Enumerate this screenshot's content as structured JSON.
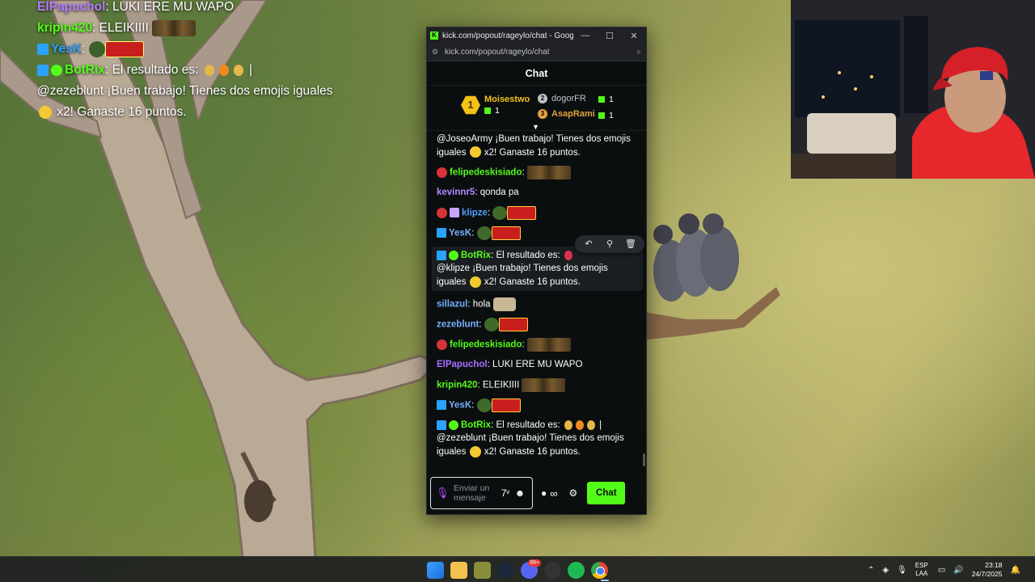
{
  "overlay_chat": [
    {
      "user": "ElPapuchol",
      "text": ": LUKI ERE MU WAPO"
    },
    {
      "user": "kripin420",
      "text": ": ELEIKIIII"
    },
    {
      "user": "YesK",
      "text": ":"
    },
    {
      "user": "BotRix",
      "text": ": El resultado es:",
      "continuation": "@zezeblunt ¡Buen trabajo! Tienes dos emojis iguales",
      "tail": "x2! Ganaste 16 puntos."
    }
  ],
  "window": {
    "title": "kick.com/popout/rageylo/chat - Google Chr...",
    "url": "kick.com/popout/rageylo/chat",
    "favicon_letter": "K"
  },
  "chat": {
    "header": "Chat",
    "leaderboard": {
      "first": {
        "rank": "1",
        "name": "Moisestwo",
        "score": "1"
      },
      "second": {
        "rank": "2",
        "name": "dogorFR",
        "score": "1"
      },
      "third": {
        "rank": "3",
        "name": "AsapRami",
        "score": "1"
      }
    },
    "messages": [
      {
        "text": "@JoseoArmy ¡Buen trabajo! Tienes dos emojis iguales",
        "tail": "x2! Ganaste 16 puntos."
      },
      {
        "user": "felipedeskisiado",
        "text": ":"
      },
      {
        "user": "kevinnr5",
        "text": ": qonda pa"
      },
      {
        "user": "klipze",
        "text": ":"
      },
      {
        "user": "YesK",
        "text": ":"
      },
      {
        "user": "BotRix",
        "text": ": El resultado es:",
        "continuation": "@klipze ¡Buen trabajo! Tienes dos emojis iguales",
        "tail": "x2! Ganaste 16 puntos."
      },
      {
        "user": "sillazul",
        "text": ": hola"
      },
      {
        "user": "zezeblunt",
        "text": ":"
      },
      {
        "user": "felipedeskisiado",
        "text": ":"
      },
      {
        "user": "ElPapuchol",
        "text": ": LUKI ERE MU WAPO"
      },
      {
        "user": "kripin420",
        "text": ": ELEIKIIII"
      },
      {
        "user": "YesK",
        "text": ":"
      },
      {
        "user": "BotRix",
        "text": ": El resultado es:",
        "continuation": "@zezeblunt ¡Buen trabajo! Tienes dos emojis iguales",
        "tail": "x2! Ganaste 16 puntos."
      }
    ],
    "input": {
      "placeholder": "Enviar un mensaje",
      "send_label": "Chat"
    }
  },
  "taskbar": {
    "language": {
      "line1": "ESP",
      "line2": "LAA"
    },
    "time": "23:18",
    "date": "24/7/2025",
    "discord_badge": "99+"
  },
  "colors": {
    "kick_green": "#53fc18",
    "rank_gold": "#f2c218",
    "rank_bronze": "#e3a33f"
  },
  "icons": [
    "mic-icon",
    "emote-icon",
    "emoji-icon",
    "dots-icon",
    "infinity-icon",
    "gear-icon",
    "reply-icon",
    "pin-icon",
    "delete-icon"
  ]
}
